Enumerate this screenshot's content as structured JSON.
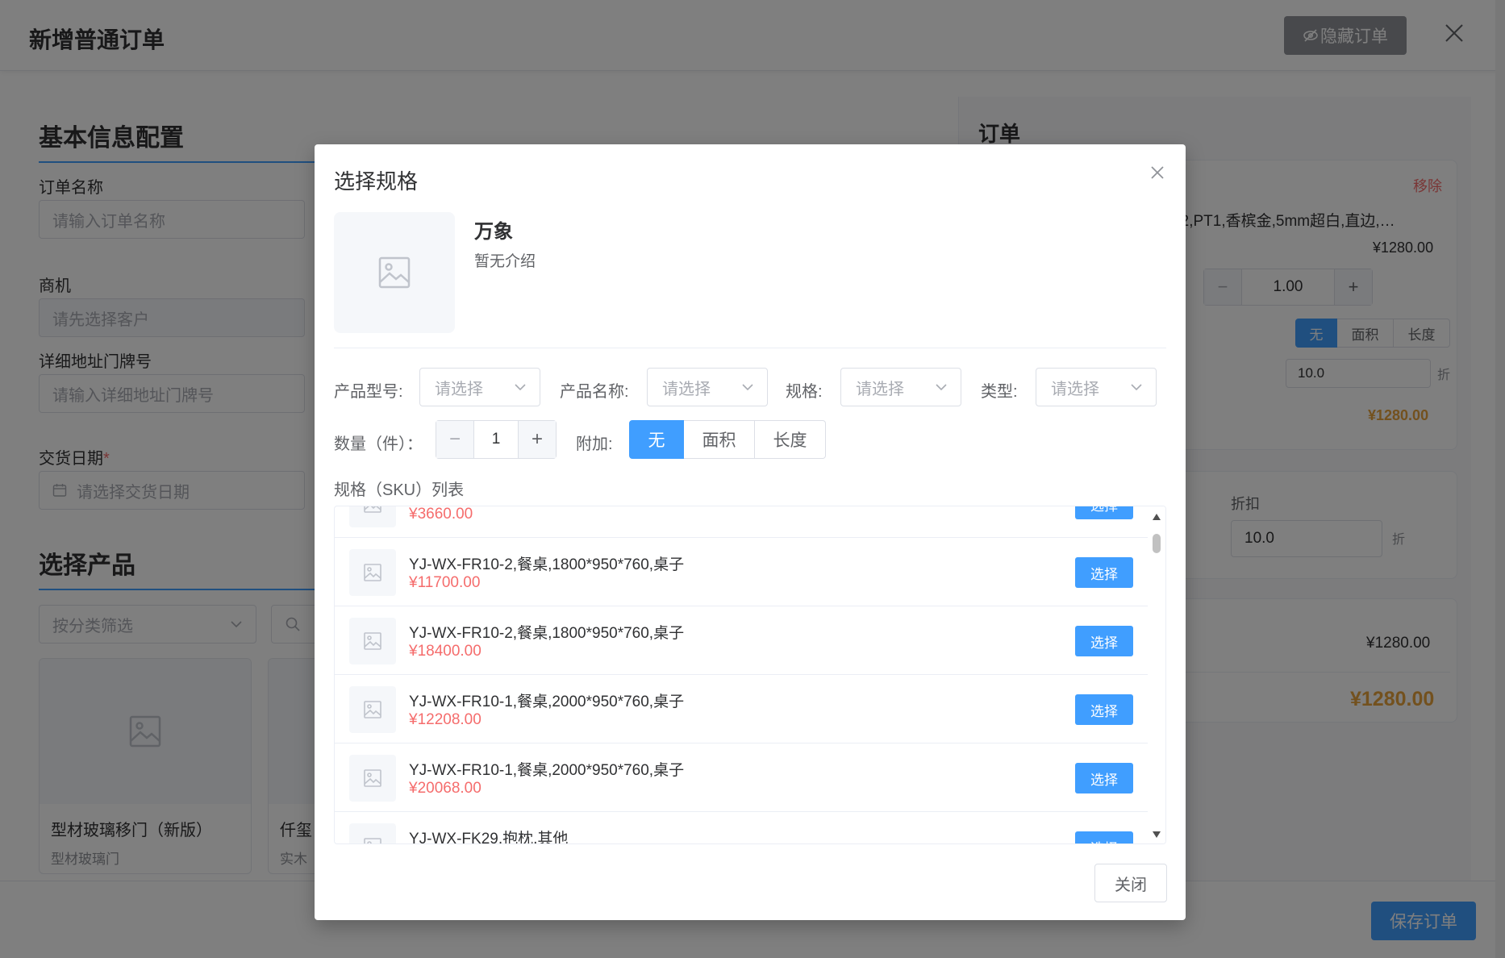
{
  "page": {
    "title": "新增普通订单",
    "hide_button": "隐藏订单",
    "save_button": "保存订单"
  },
  "basic": {
    "section_title": "基本信息配置",
    "order_name_label": "订单名称",
    "order_name_placeholder": "请输入订单名称",
    "opportunity_label": "商机",
    "opportunity_placeholder": "请先选择客户",
    "address_label": "详细地址门牌号",
    "address_placeholder": "请输入详细地址门牌号",
    "delivery_label": "交货日期",
    "delivery_required": "*",
    "delivery_placeholder": "请选择交货日期"
  },
  "products": {
    "section_title": "选择产品",
    "category_placeholder": "按分类筛选",
    "cards": [
      {
        "name": "型材玻璃移门（新版）",
        "category": "型材玻璃门"
      },
      {
        "name": "仟玺",
        "category": "实木"
      }
    ]
  },
  "order": {
    "title": "订单",
    "remove": "移除",
    "item_desc": "/LK022,PT1,香槟金,5mm超白,直边,…",
    "item_price": "¥1280.00",
    "qty": "1.00",
    "attach_options": [
      "无",
      "面积",
      "长度"
    ],
    "discount_value": "10.0",
    "discount_unit": "折",
    "line_total": "¥1280.00",
    "discount_label": "折扣",
    "discount_value2": "10.0",
    "subtotal": "¥1280.00",
    "grand_total": "¥1280.00"
  },
  "dialog": {
    "title": "选择规格",
    "product_name": "万象",
    "product_desc": "暂无介绍",
    "filters": {
      "model_label": "产品型号:",
      "name_label": "产品名称:",
      "spec_label": "规格:",
      "type_label": "类型:",
      "placeholder": "请选择"
    },
    "qty_label": "数量（件）：",
    "qty_value": "1",
    "attach_label": "附加:",
    "attach_options": [
      "无",
      "面积",
      "长度"
    ],
    "sku_title": "规格（SKU）列表",
    "select_label": "选择",
    "skus": [
      {
        "name": "",
        "price": "¥3660.00"
      },
      {
        "name": "YJ-WX-FR10-2,餐桌,1800*950*760,桌子",
        "price": "¥11700.00"
      },
      {
        "name": "YJ-WX-FR10-2,餐桌,1800*950*760,桌子",
        "price": "¥18400.00"
      },
      {
        "name": "YJ-WX-FR10-1,餐桌,2000*950*760,桌子",
        "price": "¥12208.00"
      },
      {
        "name": "YJ-WX-FR10-1,餐桌,2000*950*760,桌子",
        "price": "¥20068.00"
      },
      {
        "name": "YJ-WX-FK29,抱枕,其他",
        "price": ""
      }
    ],
    "close_button": "关闭"
  }
}
